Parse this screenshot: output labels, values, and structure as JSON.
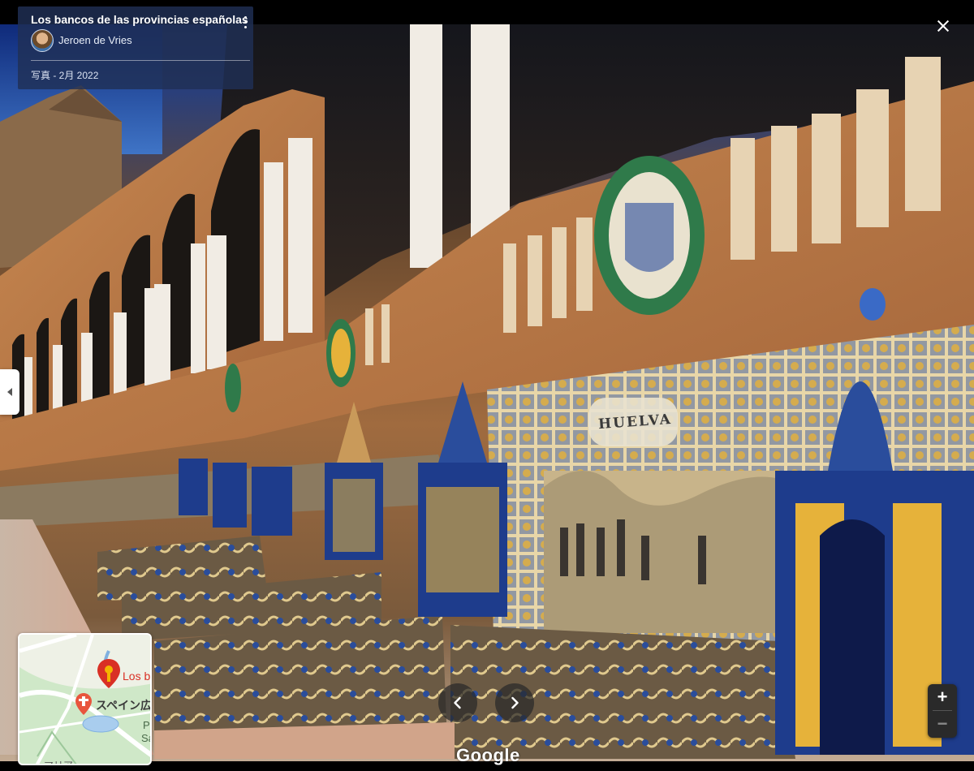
{
  "info_card": {
    "title": "Los bancos de las provincias españolas",
    "author": "Jeroen de Vries",
    "date": "写真 - 2月 2022"
  },
  "tile_panel": {
    "province_name": "HUELVA"
  },
  "minimap": {
    "place_label": "Los b",
    "spain_label": "スペイン広",
    "park_label_1": "Par",
    "park_label_2": "San S",
    "bottom_label": "マリア"
  },
  "zoom": {
    "in_label": "+",
    "out_label": "−"
  },
  "branding": {
    "logo_text": "Google"
  },
  "colors": {
    "sky": "#2a3f7a",
    "brick": "#b7743f",
    "tile_blue": "#1e3c8c",
    "tile_yellow": "#e6b23a",
    "card_bg": "#203056",
    "pin_red": "#d93025"
  },
  "icons": {
    "more": "more-vert-icon",
    "close": "close-icon",
    "prev": "chevron-left-icon",
    "next": "chevron-right-icon",
    "collapse": "chevron-left-small-icon",
    "pin": "location-pin-icon"
  }
}
